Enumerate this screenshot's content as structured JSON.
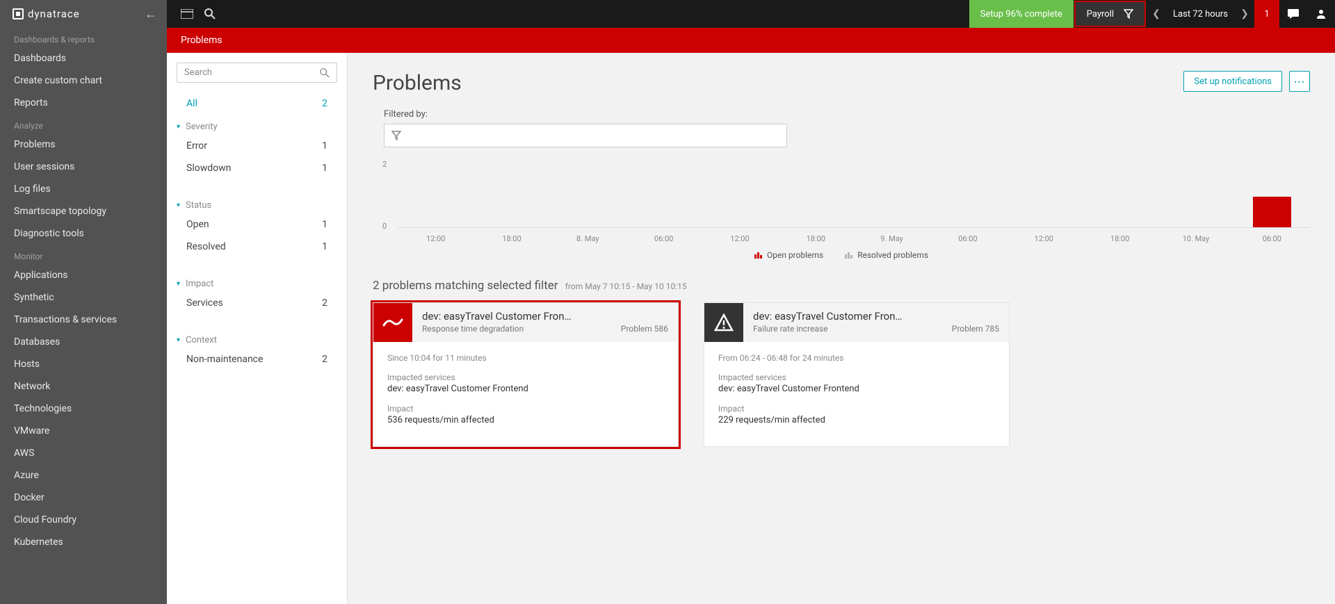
{
  "brand": "dynatrace",
  "topbar": {
    "setup": "Setup 96% complete",
    "filter_label": "Payroll",
    "timeframe": "Last 72 hours",
    "alert_count": "1"
  },
  "breadcrumb": "Problems",
  "sidebar": {
    "sections": [
      {
        "header": "Dashboards & reports",
        "items": [
          "Dashboards",
          "Create custom chart",
          "Reports"
        ]
      },
      {
        "header": "Analyze",
        "items": [
          "Problems",
          "User sessions",
          "Log files",
          "Smartscape topology",
          "Diagnostic tools"
        ]
      },
      {
        "header": "Monitor",
        "items": [
          "Applications",
          "Synthetic",
          "Transactions & services",
          "Databases",
          "Hosts",
          "Network",
          "Technologies",
          "VMware",
          "AWS",
          "Azure",
          "Docker",
          "Cloud Foundry",
          "Kubernetes"
        ]
      }
    ]
  },
  "filter_panel": {
    "search_placeholder": "Search",
    "all_label": "All",
    "all_count": "2",
    "groups": [
      {
        "name": "Severity",
        "items": [
          {
            "label": "Error",
            "count": "1"
          },
          {
            "label": "Slowdown",
            "count": "1"
          }
        ]
      },
      {
        "name": "Status",
        "items": [
          {
            "label": "Open",
            "count": "1"
          },
          {
            "label": "Resolved",
            "count": "1"
          }
        ]
      },
      {
        "name": "Impact",
        "items": [
          {
            "label": "Services",
            "count": "2"
          }
        ]
      },
      {
        "name": "Context",
        "items": [
          {
            "label": "Non-maintenance",
            "count": "2"
          }
        ]
      }
    ]
  },
  "problems": {
    "title": "Problems",
    "setup_notifications": "Set up notifications",
    "filtered_by": "Filtered by:",
    "matching": "2 problems matching selected filter",
    "matching_range": "from May 7 10:15 - May 10 10:15",
    "legend_open": "Open problems",
    "legend_resolved": "Resolved problems"
  },
  "chart_data": {
    "type": "bar",
    "ylim": [
      0,
      2
    ],
    "y_ticks": [
      "2",
      "0"
    ],
    "categories": [
      "12:00",
      "18:00",
      "8. May",
      "06:00",
      "12:00",
      "18:00",
      "9. May",
      "06:00",
      "12:00",
      "18:00",
      "10. May",
      "06:00"
    ],
    "series": [
      {
        "name": "Open problems",
        "color": "#cc0000",
        "values": [
          0,
          0,
          0,
          0,
          0,
          0,
          0,
          0,
          0,
          0,
          0,
          1
        ]
      },
      {
        "name": "Resolved problems",
        "color": "#b5b5b5",
        "values": [
          0,
          0,
          0,
          0,
          0,
          0,
          0,
          0,
          0,
          0,
          0,
          0
        ]
      }
    ]
  },
  "cards": [
    {
      "icon": "service-red",
      "title": "dev: easyTravel Customer Fron…",
      "subtitle": "Response time degradation",
      "problem_id": "Problem 586",
      "time": "Since 10:04 for 11 minutes",
      "impacted_label": "Impacted services",
      "impacted_value": "dev: easyTravel Customer Frontend",
      "impact_label": "Impact",
      "impact_value": "536 requests/min affected",
      "highlight": true
    },
    {
      "icon": "warning-dark",
      "title": "dev: easyTravel Customer Fron…",
      "subtitle": "Failure rate increase",
      "problem_id": "Problem 785",
      "time": "From 06:24 - 06:48 for 24 minutes",
      "impacted_label": "Impacted services",
      "impacted_value": "dev: easyTravel Customer Frontend",
      "impact_label": "Impact",
      "impact_value": "229 requests/min affected",
      "highlight": false
    }
  ]
}
